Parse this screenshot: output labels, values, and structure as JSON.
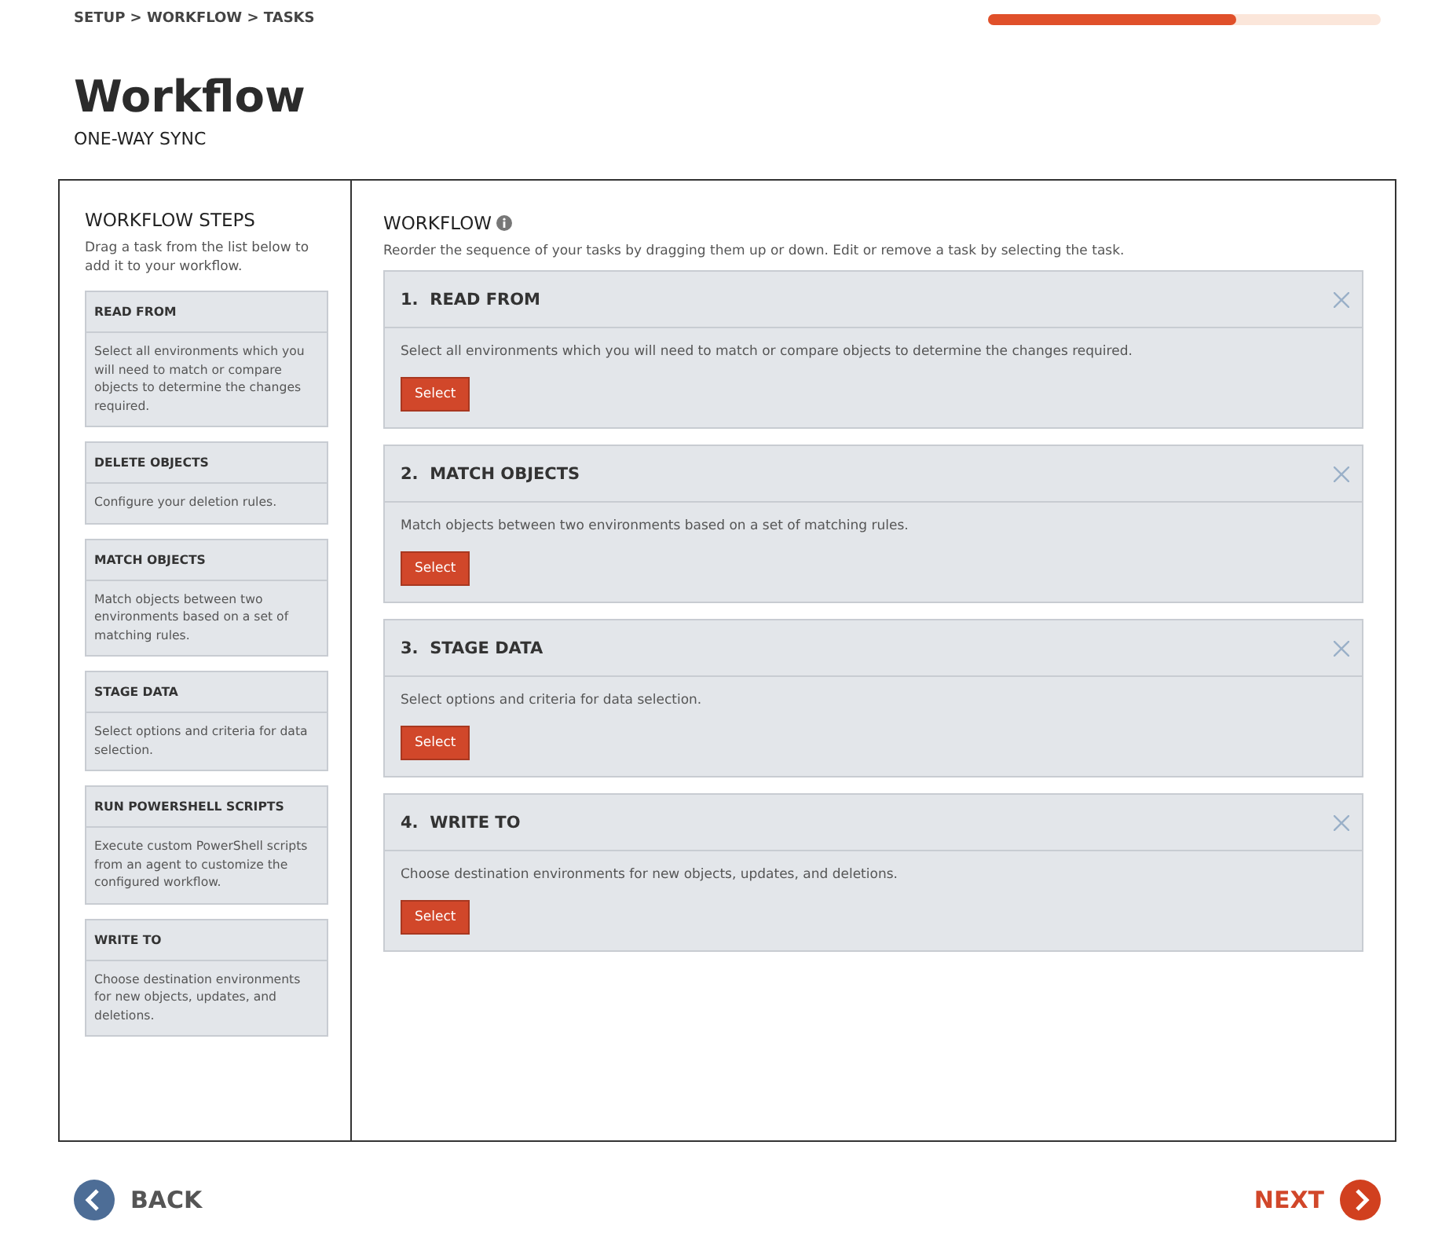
{
  "breadcrumb": "SETUP > WORKFLOW > TASKS",
  "progress": {
    "level": 0.63
  },
  "title": "Workflow",
  "subtitle": "ONE-WAY SYNC",
  "steps_panel": {
    "title": "WORKFLOW STEPS",
    "hint": "Drag a task from the list below to add it to your workflow.",
    "items": [
      {
        "title": "READ FROM",
        "description": "Select all environments which you will need to match or compare objects to determine the changes required."
      },
      {
        "title": "DELETE OBJECTS",
        "description": "Configure your deletion rules."
      },
      {
        "title": "MATCH OBJECTS",
        "description": "Match objects between two environments based on a set of matching rules."
      },
      {
        "title": "STAGE DATA",
        "description": "Select options and criteria for data selection."
      },
      {
        "title": "RUN POWERSHELL SCRIPTS",
        "description": "Execute custom PowerShell scripts from an agent to customize the configured workflow."
      },
      {
        "title": "WRITE TO",
        "description": "Choose destination environments for new objects, updates, and deletions."
      }
    ]
  },
  "workflow": {
    "title": "WORKFLOW",
    "hint": "Reorder the sequence of your tasks by dragging them up or down. Edit or remove a task by selecting the task.",
    "tasks": [
      {
        "number": "1.",
        "title": "READ FROM",
        "description": "Select all environments which you will need to match or compare objects to determine the changes required.",
        "button": "Select"
      },
      {
        "number": "2.",
        "title": "MATCH OBJECTS",
        "description": "Match objects between two environments based on a set of matching rules.",
        "button": "Select"
      },
      {
        "number": "3.",
        "title": "STAGE DATA",
        "description": "Select options and criteria for data selection.",
        "button": "Select"
      },
      {
        "number": "4.",
        "title": "WRITE TO",
        "description": "Choose destination environments for new objects, updates, and deletions.",
        "button": "Select"
      }
    ]
  },
  "back": "BACK",
  "next": "NEXT"
}
